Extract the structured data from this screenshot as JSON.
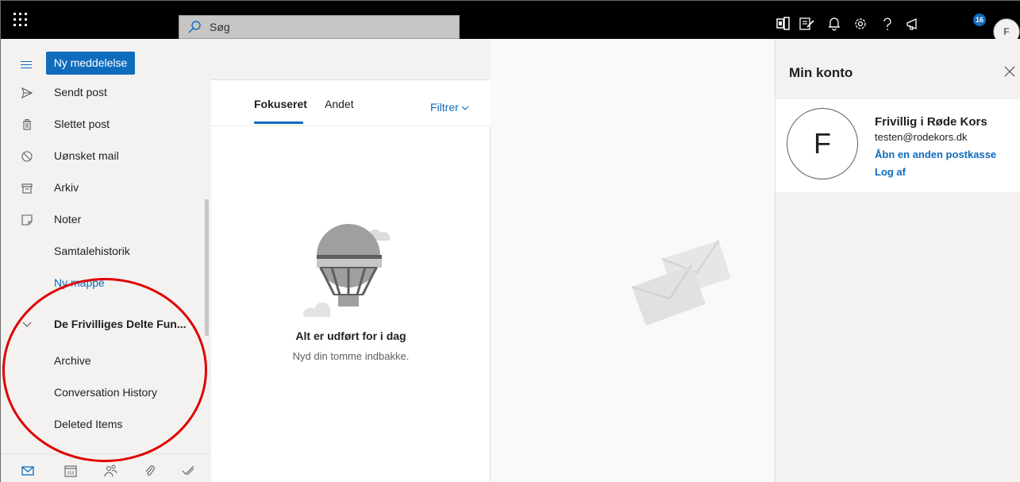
{
  "topbar": {
    "search_placeholder": "Søg",
    "notification_badge": "16",
    "me_initial": "F",
    "icons": [
      "waffle-icon",
      "office-icon",
      "tasks-icon",
      "bell-icon",
      "gear-icon",
      "help-icon",
      "megaphone-icon"
    ]
  },
  "command": {
    "new_message": "Ny meddelelse"
  },
  "folders": {
    "items": [
      {
        "label": "Sendt post",
        "icon": "send-icon"
      },
      {
        "label": "Slettet post",
        "icon": "trash-icon"
      },
      {
        "label": "Uønsket mail",
        "icon": "blocked-icon"
      },
      {
        "label": "Arkiv",
        "icon": "archive-icon"
      },
      {
        "label": "Noter",
        "icon": "note-icon"
      },
      {
        "label": "Samtalehistorik"
      },
      {
        "label": "Ny mappe"
      }
    ],
    "shared_group": {
      "label": "De Frivilliges Delte Fun...",
      "items": [
        {
          "label": "Archive"
        },
        {
          "label": "Conversation History"
        },
        {
          "label": "Deleted Items"
        }
      ]
    }
  },
  "modules": [
    "mail-icon",
    "calendar-icon",
    "people-icon",
    "files-icon",
    "todo-icon"
  ],
  "message_list": {
    "tabs": [
      {
        "label": "Fokuseret",
        "active": true
      },
      {
        "label": "Andet",
        "active": false
      }
    ],
    "filter_label": "Filtrer",
    "empty_title": "Alt er udført for i dag",
    "empty_subtitle": "Nyd din tomme indbakke."
  },
  "account": {
    "title": "Min konto",
    "avatar_initial": "F",
    "name": "Frivillig i Røde Kors",
    "email": "testen@rodekors.dk",
    "open_other_mailbox": "Åbn en anden postkasse",
    "sign_out": "Log af"
  },
  "colors": {
    "accent": "#0f6cbd",
    "topbar": "#000000",
    "annotation": "#e00000"
  }
}
